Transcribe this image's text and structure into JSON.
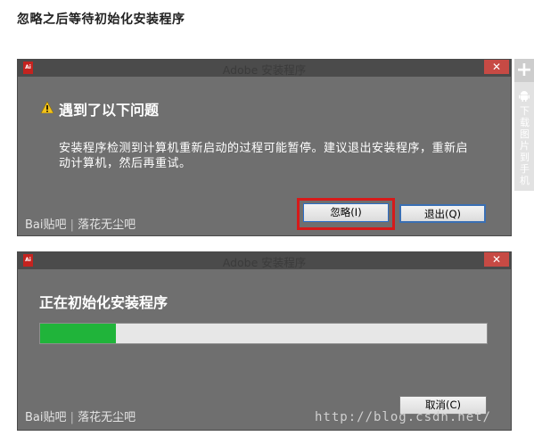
{
  "heading": "忽略之后等待初始化安装程序",
  "dialog1": {
    "title": "Adobe 安装程序",
    "icon_label": "Ai",
    "close_glyph": "✕",
    "problem_heading": "遇到了以下问题",
    "message": "安装程序检测到计算机重新启动的过程可能暂停。建议退出安装程序，重新启动计算机，然后再重试。",
    "ignore_button": "忽略(I)",
    "quit_button": "退出(Q)",
    "watermark_logo": "Bai贴吧",
    "watermark_forum": "落花无尘吧"
  },
  "dialog2": {
    "title": "Adobe 安装程序",
    "icon_label": "Ai",
    "close_glyph": "✕",
    "progress_heading": "正在初始化安装程序",
    "progress": 0.17,
    "cancel_button": "取消(C)",
    "watermark_logo": "Bai贴吧",
    "watermark_forum": "落花无尘吧"
  },
  "sidebar": {
    "plus_glyph": "+",
    "download_text": "下载图片到手机"
  },
  "url_watermark": "http://blog.csdn.net/",
  "colors": {
    "progress_fill": "#20b43a",
    "highlight_border": "#d61a1a",
    "dialog_bg": "#6f6f6f",
    "titlebar_bg": "#4b4b4b"
  },
  "icons": [
    "warning-icon",
    "close-icon",
    "android-icon",
    "plus-icon",
    "adobe-app-icon"
  ]
}
